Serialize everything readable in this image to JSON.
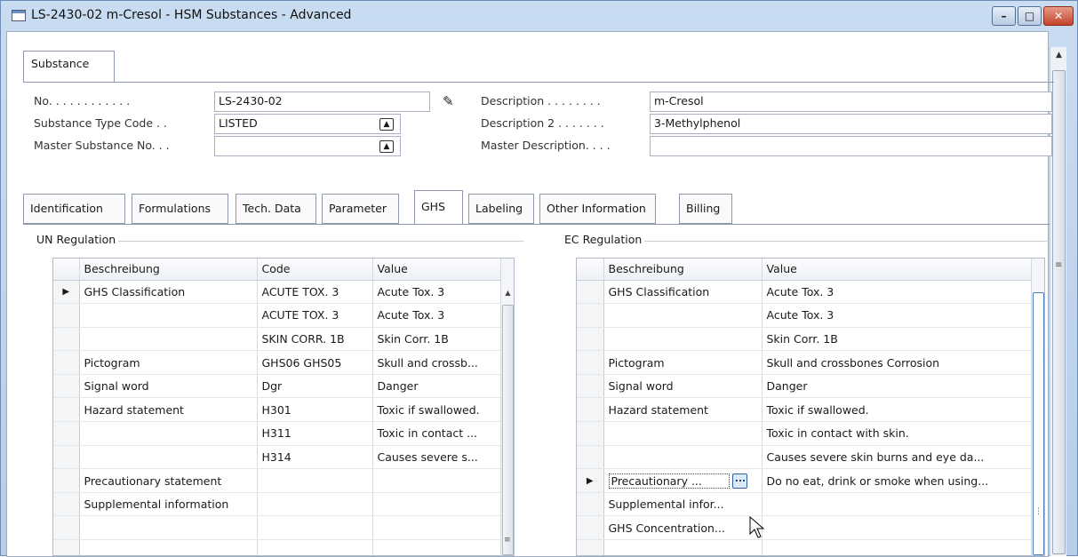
{
  "window": {
    "title": "LS-2430-02 m-Cresol - HSM Substances - Advanced"
  },
  "header_tab": {
    "label": "Substance"
  },
  "form": {
    "no_label": "No. . . . . . . . . . . .",
    "no_value": "LS-2430-02",
    "type_label": "Substance Type Code . .",
    "type_value": "LISTED",
    "master_label": "Master Substance No. . .",
    "master_value": "",
    "desc_label": "Description . . . . . . . .",
    "desc_value": "m-Cresol",
    "desc2_label": "Description 2 . . . . . . .",
    "desc2_value": "3-Methylphenol",
    "master_desc_label": "Master Description. . . .",
    "master_desc_value": ""
  },
  "tabs": [
    {
      "label": "Identification"
    },
    {
      "label": "Formulations"
    },
    {
      "label": "Tech. Data"
    },
    {
      "label": "Parameter"
    },
    {
      "label": "GHS"
    },
    {
      "label": "Labeling"
    },
    {
      "label": "Other Information"
    },
    {
      "label": "Billing"
    }
  ],
  "active_tab": "GHS",
  "un": {
    "title": "UN Regulation",
    "headers": {
      "desc": "Beschreibung",
      "code": "Code",
      "value": "Value"
    },
    "rows": [
      {
        "marker": "▶",
        "desc": "GHS Classification",
        "code": "ACUTE TOX. 3",
        "value": "Acute Tox. 3"
      },
      {
        "marker": "",
        "desc": "",
        "code": "ACUTE TOX. 3",
        "value": "Acute Tox. 3"
      },
      {
        "marker": "",
        "desc": "",
        "code": "SKIN CORR. 1B",
        "value": "Skin Corr. 1B"
      },
      {
        "marker": "",
        "desc": "Pictogram",
        "code": "GHS06  GHS05",
        "value": "Skull and crossb..."
      },
      {
        "marker": "",
        "desc": "Signal word",
        "code": "Dgr",
        "value": "Danger"
      },
      {
        "marker": "",
        "desc": "Hazard statement",
        "code": "H301",
        "value": "Toxic if swallowed."
      },
      {
        "marker": "",
        "desc": "",
        "code": "H311",
        "value": "Toxic in contact ..."
      },
      {
        "marker": "",
        "desc": "",
        "code": "H314",
        "value": "Causes severe s..."
      },
      {
        "marker": "",
        "desc": "Precautionary statement",
        "code": "",
        "value": ""
      },
      {
        "marker": "",
        "desc": "Supplemental information",
        "code": "",
        "value": ""
      },
      {
        "marker": "",
        "desc": "",
        "code": "",
        "value": ""
      },
      {
        "marker": "",
        "desc": "",
        "code": "",
        "value": ""
      }
    ]
  },
  "ec": {
    "title": "EC Regulation",
    "headers": {
      "desc": "Beschreibung",
      "value": "Value"
    },
    "rows": [
      {
        "marker": "",
        "desc": "GHS Classification",
        "value": "Acute Tox. 3"
      },
      {
        "marker": "",
        "desc": "",
        "value": "Acute Tox. 3"
      },
      {
        "marker": "",
        "desc": "",
        "value": "Skin Corr. 1B"
      },
      {
        "marker": "",
        "desc": "Pictogram",
        "value": "Skull and crossbones  Corrosion"
      },
      {
        "marker": "",
        "desc": "Signal word",
        "value": "Danger"
      },
      {
        "marker": "",
        "desc": "Hazard statement",
        "value": "Toxic if swallowed."
      },
      {
        "marker": "",
        "desc": "",
        "value": "Toxic in contact with skin."
      },
      {
        "marker": "",
        "desc": "",
        "value": "Causes severe skin burns and eye da..."
      },
      {
        "marker": "▶",
        "desc": "Precautionary ...",
        "value": "Do no eat, drink or smoke when using..."
      },
      {
        "marker": "",
        "desc": "Supplemental infor...",
        "value": ""
      },
      {
        "marker": "",
        "desc": "GHS Concentration...",
        "value": ""
      },
      {
        "marker": "",
        "desc": "",
        "value": ""
      }
    ]
  },
  "icons": {
    "window": "table-window-icon",
    "edit": "pencil-icon",
    "lookup": "lookup-arrow-icon",
    "assist": "assist-edit-ellipsis-icon",
    "minimize": "minimize-icon",
    "maximize": "maximize-icon",
    "close": "close-icon"
  },
  "colors": {
    "close": "#c4442b",
    "titlebar": "#c9dcf1"
  }
}
